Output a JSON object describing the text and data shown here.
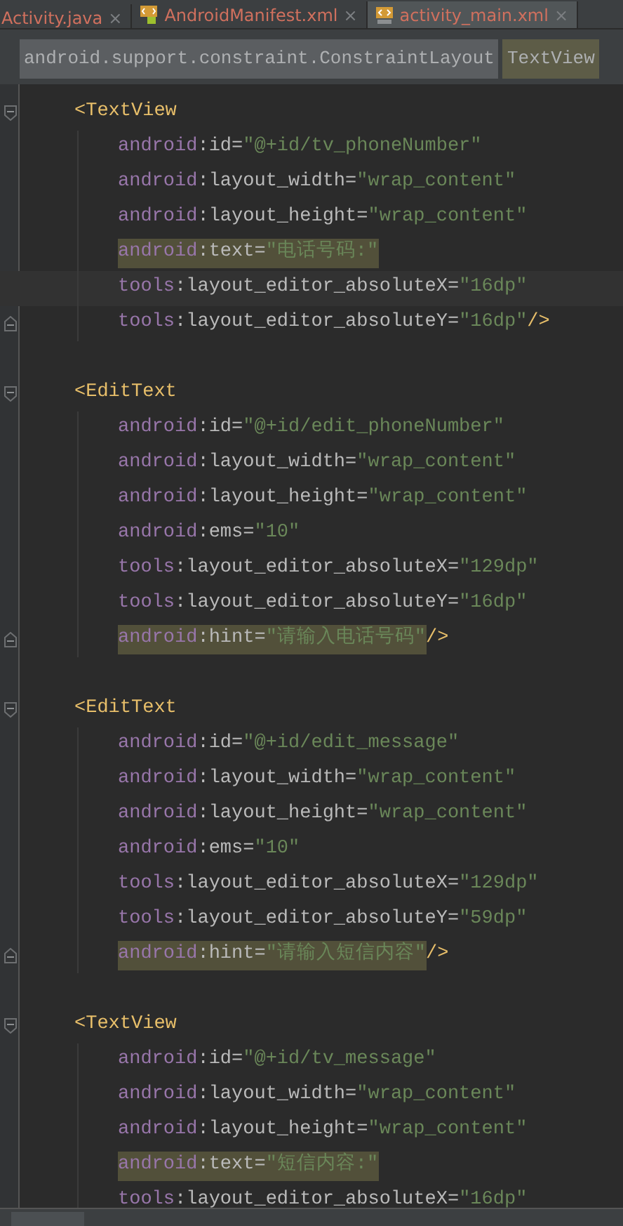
{
  "tabs": [
    {
      "label": "Activity.java",
      "kind": "java",
      "close": "×",
      "selected": false
    },
    {
      "label": "AndroidManifest.xml",
      "kind": "manifest",
      "close": "×",
      "selected": false
    },
    {
      "label": "activity_main.xml",
      "kind": "layout",
      "close": "×",
      "selected": true
    }
  ],
  "breadcrumbs": [
    {
      "label": "android.support.constraint.ConstraintLayout",
      "selected": false
    },
    {
      "label": "TextView",
      "selected": true
    }
  ],
  "lines": [
    {
      "kind": "open",
      "tag": "<TextView",
      "fold_start": true
    },
    {
      "kind": "attr",
      "prefix": "android",
      "rest": ":id=",
      "value": "\"@+id/tv_phoneNumber\"",
      "highlighted": false,
      "current": false
    },
    {
      "kind": "attr",
      "prefix": "android",
      "rest": ":layout_width=",
      "value": "\"wrap_content\"",
      "highlighted": false,
      "current": false
    },
    {
      "kind": "attr",
      "prefix": "android",
      "rest": ":layout_height=",
      "value": "\"wrap_content\"",
      "highlighted": false,
      "current": false
    },
    {
      "kind": "attr",
      "prefix": "android",
      "rest": ":text=",
      "value": "\"电话号码:\"",
      "highlighted": true,
      "current": false
    },
    {
      "kind": "attr",
      "prefix": "tools",
      "rest": ":layout_editor_absoluteX=",
      "value": "\"16dp\"",
      "highlighted": false,
      "current": true
    },
    {
      "kind": "attr",
      "prefix": "tools",
      "rest": ":layout_editor_absoluteY=",
      "value": "\"16dp\"",
      "close": " />",
      "highlighted": false,
      "current": false,
      "fold_end": true
    },
    {
      "kind": "blank"
    },
    {
      "kind": "open",
      "tag": "<EditText",
      "fold_start": true
    },
    {
      "kind": "attr",
      "prefix": "android",
      "rest": ":id=",
      "value": "\"@+id/edit_phoneNumber\"",
      "highlighted": false,
      "current": false
    },
    {
      "kind": "attr",
      "prefix": "android",
      "rest": ":layout_width=",
      "value": "\"wrap_content\"",
      "highlighted": false,
      "current": false
    },
    {
      "kind": "attr",
      "prefix": "android",
      "rest": ":layout_height=",
      "value": "\"wrap_content\"",
      "highlighted": false,
      "current": false
    },
    {
      "kind": "attr",
      "prefix": "android",
      "rest": ":ems=",
      "value": "\"10\"",
      "highlighted": false,
      "current": false
    },
    {
      "kind": "attr",
      "prefix": "tools",
      "rest": ":layout_editor_absoluteX=",
      "value": "\"129dp\"",
      "highlighted": false,
      "current": false
    },
    {
      "kind": "attr",
      "prefix": "tools",
      "rest": ":layout_editor_absoluteY=",
      "value": "\"16dp\"",
      "highlighted": false,
      "current": false
    },
    {
      "kind": "attr",
      "prefix": "android",
      "rest": ":hint=",
      "value": "\"请输入电话号码\"",
      "close": "/>",
      "highlighted": true,
      "current": false,
      "fold_end": true
    },
    {
      "kind": "blank"
    },
    {
      "kind": "open",
      "tag": "<EditText",
      "fold_start": true
    },
    {
      "kind": "attr",
      "prefix": "android",
      "rest": ":id=",
      "value": "\"@+id/edit_message\"",
      "highlighted": false,
      "current": false
    },
    {
      "kind": "attr",
      "prefix": "android",
      "rest": ":layout_width=",
      "value": "\"wrap_content\"",
      "highlighted": false,
      "current": false
    },
    {
      "kind": "attr",
      "prefix": "android",
      "rest": ":layout_height=",
      "value": "\"wrap_content\"",
      "highlighted": false,
      "current": false
    },
    {
      "kind": "attr",
      "prefix": "android",
      "rest": ":ems=",
      "value": "\"10\"",
      "highlighted": false,
      "current": false
    },
    {
      "kind": "attr",
      "prefix": "tools",
      "rest": ":layout_editor_absoluteX=",
      "value": "\"129dp\"",
      "highlighted": false,
      "current": false
    },
    {
      "kind": "attr",
      "prefix": "tools",
      "rest": ":layout_editor_absoluteY=",
      "value": "\"59dp\"",
      "highlighted": false,
      "current": false
    },
    {
      "kind": "attr",
      "prefix": "android",
      "rest": ":hint=",
      "value": "\"请输入短信内容\"",
      "close": "/>",
      "highlighted": true,
      "current": false,
      "fold_end": true
    },
    {
      "kind": "blank"
    },
    {
      "kind": "open",
      "tag": "<TextView",
      "fold_start": true
    },
    {
      "kind": "attr",
      "prefix": "android",
      "rest": ":id=",
      "value": "\"@+id/tv_message\"",
      "highlighted": false,
      "current": false
    },
    {
      "kind": "attr",
      "prefix": "android",
      "rest": ":layout_width=",
      "value": "\"wrap_content\"",
      "highlighted": false,
      "current": false
    },
    {
      "kind": "attr",
      "prefix": "android",
      "rest": ":layout_height=",
      "value": "\"wrap_content\"",
      "highlighted": false,
      "current": false
    },
    {
      "kind": "attr",
      "prefix": "android",
      "rest": ":text=",
      "value": "\"短信内容:\"",
      "highlighted": true,
      "current": false
    },
    {
      "kind": "attr",
      "prefix": "tools",
      "rest": ":layout_editor_absoluteX=",
      "value": "\"16dp\"",
      "highlighted": false,
      "current": false
    }
  ]
}
